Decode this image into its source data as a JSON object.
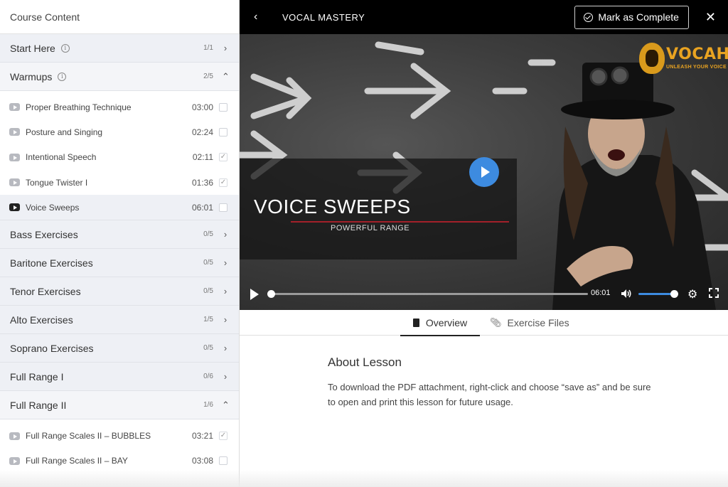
{
  "sidebar": {
    "title": "Course Content",
    "sections": [
      {
        "name": "Start Here",
        "count": "1/1",
        "info": "i",
        "expanded": false
      },
      {
        "name": "Warmups",
        "count": "2/5",
        "info": "i",
        "expanded": true,
        "lessons": [
          {
            "title": "Proper Breathing Technique",
            "duration": "03:00",
            "completed": false,
            "active": false
          },
          {
            "title": "Posture and Singing",
            "duration": "02:24",
            "completed": false,
            "active": false
          },
          {
            "title": "Intentional Speech",
            "duration": "02:11",
            "completed": true,
            "active": false
          },
          {
            "title": "Tongue Twister I",
            "duration": "01:36",
            "completed": true,
            "active": false
          },
          {
            "title": "Voice Sweeps",
            "duration": "06:01",
            "completed": false,
            "active": true
          }
        ]
      },
      {
        "name": "Bass Exercises",
        "count": "0/5",
        "expanded": false
      },
      {
        "name": "Baritone Exercises",
        "count": "0/5",
        "expanded": false
      },
      {
        "name": "Tenor Exercises",
        "count": "0/5",
        "expanded": false
      },
      {
        "name": "Alto Exercises",
        "count": "1/5",
        "expanded": false
      },
      {
        "name": "Soprano Exercises",
        "count": "0/5",
        "expanded": false
      },
      {
        "name": "Full Range I",
        "count": "0/6",
        "expanded": false
      },
      {
        "name": "Full Range II",
        "count": "1/6",
        "expanded": true,
        "lessons": [
          {
            "title": "Full Range Scales II – BUBBLES",
            "duration": "03:21",
            "completed": true,
            "active": false
          },
          {
            "title": "Full Range Scales II – BAY",
            "duration": "03:08",
            "completed": false,
            "active": false
          }
        ]
      }
    ]
  },
  "topbar": {
    "course_title": "VOCAL MASTERY",
    "complete_label": "Mark as Complete",
    "back_icon": "chevron-left-icon",
    "close_icon": "close-icon"
  },
  "video": {
    "title_overlay": "VOICE SWEEPS",
    "subtitle_overlay": "POWERFUL RANGE",
    "logo_text": "VOCAH",
    "logo_tagline": "UNLEASH YOUR VOICE",
    "duration": "06:01",
    "progress": 0,
    "volume": 1.0,
    "accent_color": "#3d8be0"
  },
  "tabs": [
    {
      "label": "Overview",
      "active": true
    },
    {
      "label": "Exercise Files",
      "active": false
    }
  ],
  "lesson_content": {
    "heading": "About Lesson",
    "body": "To download the PDF attachment, right-click and choose “save as” and be sure to open and print this lesson for future usage."
  }
}
